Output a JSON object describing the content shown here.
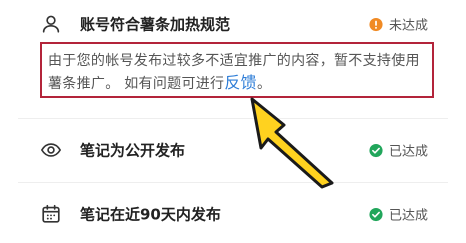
{
  "requirements": [
    {
      "title": "账号符合薯条加热规范",
      "icon": "user-icon",
      "status": {
        "label": "未达成",
        "icon": "warning-icon",
        "color": "#f08a24"
      }
    },
    {
      "title": "笔记为公开发布",
      "icon": "eye-icon",
      "status": {
        "label": "已达成",
        "icon": "check-circle-icon",
        "color": "#21a65b"
      }
    },
    {
      "title": "笔记在近90天内发布",
      "icon": "calendar-icon",
      "status": {
        "label": "已达成",
        "icon": "check-circle-icon",
        "color": "#21a65b"
      }
    }
  ],
  "notice": {
    "text": "由于您的帐号发布过较多不适宜推广的内容，暂不支持使用薯条推广。 如有问题可进行",
    "link_label": "反馈",
    "suffix": "。"
  },
  "colors": {
    "highlight_border": "#b3243a",
    "link": "#2e7dd7",
    "arrow_fill": "#ffd21f"
  }
}
